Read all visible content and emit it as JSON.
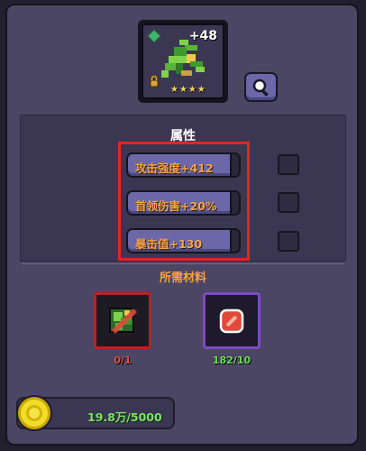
{
  "item": {
    "level": "+48",
    "stars": "★★★★",
    "icon": "green-dragon-weapon"
  },
  "attributes": {
    "title": "属性",
    "items": [
      {
        "label": "攻击强度+412"
      },
      {
        "label": "首领伤害+20%"
      },
      {
        "label": "暴击值+130"
      }
    ]
  },
  "materials": {
    "title": "所需材料",
    "items": [
      {
        "count": "0/1",
        "count_color": "#e24b3a",
        "icon": "weapon-material-icon"
      },
      {
        "count": "182/10",
        "count_color": "#6fd95a",
        "icon": "red-gem-icon"
      }
    ]
  },
  "gold": {
    "value": "19.8万/5000",
    "icon": "coin-icon"
  },
  "colors": {
    "accent_orange": "#f5a24a",
    "highlight_red": "#e5251d",
    "panel": "#4a4663"
  }
}
